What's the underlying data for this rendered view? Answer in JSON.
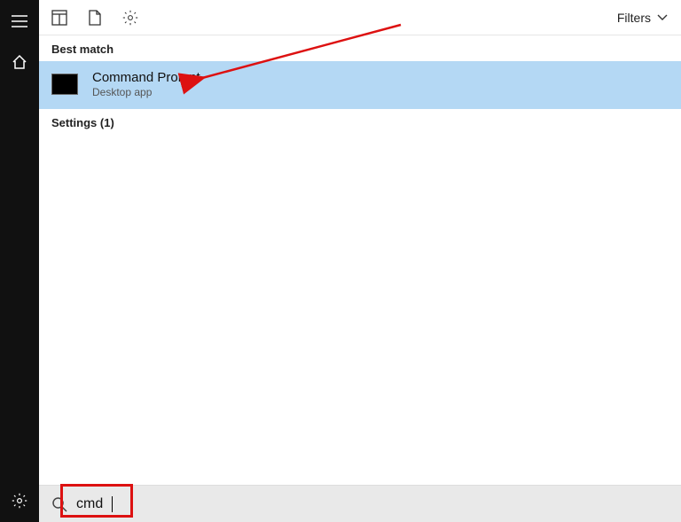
{
  "filters_label": "Filters",
  "sections": {
    "best_match": "Best match",
    "settings": "Settings (1)"
  },
  "result": {
    "title": "Command Prompt",
    "subtitle": "Desktop app"
  },
  "search": {
    "value": "cmd"
  }
}
